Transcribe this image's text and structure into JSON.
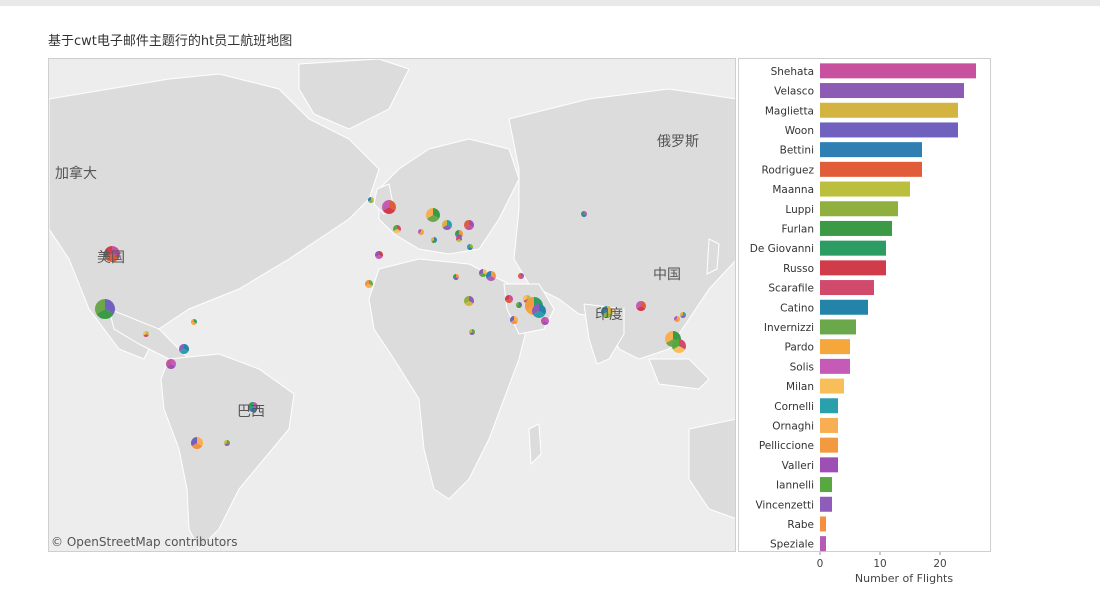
{
  "page": {
    "title": "基于cwt电子邮件主题行的ht员工航班地图"
  },
  "map": {
    "attribution": "© OpenStreetMap contributors",
    "labels": [
      {
        "id": "canada",
        "text": "加拿大"
      },
      {
        "id": "usa",
        "text": "美国"
      },
      {
        "id": "brazil",
        "text": "巴西"
      },
      {
        "id": "russia",
        "text": "俄罗斯"
      },
      {
        "id": "china",
        "text": "中国"
      },
      {
        "id": "india",
        "text": "印度"
      }
    ],
    "colors": {
      "ocean": "#ededed",
      "land": "#dcdcdc",
      "border": "#ffffff"
    }
  },
  "chart_data": {
    "type": "bar",
    "orientation": "horizontal",
    "xlabel": "Number of Flights",
    "xlim": [
      0,
      28
    ],
    "xticks": [
      0,
      10,
      20
    ],
    "categories": [
      "Shehata",
      "Velasco",
      "Maglietta",
      "Woon",
      "Bettini",
      "Rodriguez",
      "Maanna",
      "Luppi",
      "Furlan",
      "De Giovanni",
      "Russo",
      "Scarafile",
      "Catino",
      "Invernizzi",
      "Pardo",
      "Solis",
      "Milan",
      "Cornelli",
      "Ornaghi",
      "Pelliccione",
      "Valleri",
      "Iannelli",
      "Vincenzetti",
      "Rabe",
      "Speziale"
    ],
    "values": [
      26,
      24,
      23,
      23,
      17,
      17,
      15,
      13,
      12,
      11,
      11,
      9,
      8,
      6,
      5,
      5,
      4,
      3,
      3,
      3,
      3,
      2,
      2,
      1,
      1
    ],
    "colors": [
      "#c7509f",
      "#8c5cb5",
      "#d4b441",
      "#7061bf",
      "#2f7fb2",
      "#e15d3a",
      "#bcbf3e",
      "#8fb03f",
      "#3a9a45",
      "#2d9c62",
      "#d03c4a",
      "#d14a6c",
      "#2383a8",
      "#6aa84b",
      "#f5a73c",
      "#c55bb6",
      "#f8be5a",
      "#2aa0ad",
      "#f8ae52",
      "#f29a3f",
      "#9d4fb6",
      "#58a741",
      "#8f5cbb",
      "#f5913c",
      "#b65ab8"
    ]
  }
}
